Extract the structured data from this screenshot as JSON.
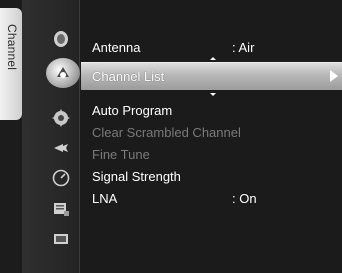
{
  "category": {
    "label": "Channel",
    "icons": [
      {
        "name": "picture-icon"
      },
      {
        "name": "channel-icon",
        "active": true
      },
      {
        "name": "setup-icon"
      },
      {
        "name": "input-icon"
      },
      {
        "name": "application-icon"
      },
      {
        "name": "support-icon"
      },
      {
        "name": "screen-icon"
      }
    ]
  },
  "menu": {
    "items": [
      {
        "label": "Antenna",
        "value": ": Air",
        "state": "normal"
      },
      {
        "label": "Channel List",
        "value": "",
        "state": "selected"
      },
      {
        "label": "Auto Program",
        "value": "",
        "state": "normal"
      },
      {
        "label": "Clear Scrambled Channel",
        "value": "",
        "state": "disabled"
      },
      {
        "label": "Fine Tune",
        "value": "",
        "state": "disabled"
      },
      {
        "label": "Signal Strength",
        "value": "",
        "state": "normal"
      },
      {
        "label": "LNA",
        "value": ": On",
        "state": "normal"
      }
    ]
  },
  "colors": {
    "background": "#1b1b1b",
    "text": "#ffffff",
    "disabled_text": "#7a7a7a",
    "highlight": "#b7b7b7"
  }
}
